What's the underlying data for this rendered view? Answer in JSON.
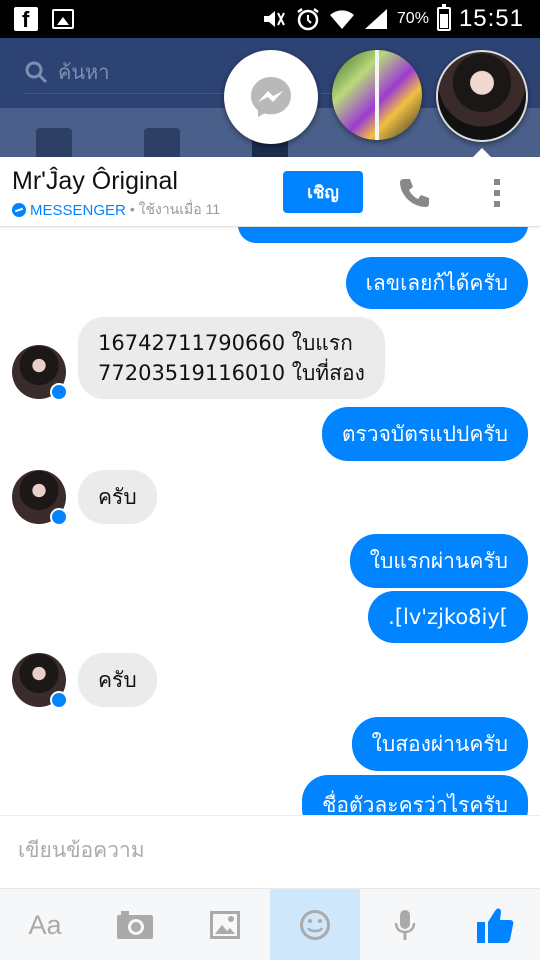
{
  "status_bar": {
    "battery": "70%",
    "time": "15:51",
    "icons": [
      "facebook-icon",
      "image-notification-icon",
      "mute-icon",
      "alarm-icon",
      "wifi-icon",
      "signal-icon",
      "battery-icon"
    ]
  },
  "facebook": {
    "search_placeholder": "ค้นหา",
    "brand_color": "#2d4373"
  },
  "chat_heads": [
    "messenger-chathead",
    "friend-photo-chathead",
    "anime-avatar-chathead"
  ],
  "chat": {
    "name": "Mr'Ĵay Ôriginal",
    "brand": "MESSENGER",
    "active_status": "• ใช้งานเมื่อ 11",
    "invite_label": "เชิญ",
    "accent": "#0084ff"
  },
  "messages": [
    {
      "dir": "out",
      "text": ""
    },
    {
      "dir": "out",
      "text": "เลขเลยก้ได้ครับ"
    },
    {
      "dir": "in",
      "lines": [
        "16742711790660 ใบแรก",
        "77203519116010 ใบที่สอง"
      ]
    },
    {
      "dir": "out",
      "text": "ตรวจบัตรแปปครับ"
    },
    {
      "dir": "in",
      "text": "ครับ"
    },
    {
      "dir": "out",
      "text": "ใบแรกผ่านครับ"
    },
    {
      "dir": "out",
      "text": ".[lv'zjko8iy["
    },
    {
      "dir": "in",
      "text": "ครับ"
    },
    {
      "dir": "out",
      "text": "ใบสองผ่านครับ"
    },
    {
      "dir": "out",
      "text": "ชื่อตัวละครว่าไรครับ"
    }
  ],
  "composer": {
    "placeholder": "เขียนข้อความ"
  },
  "toolbar": {
    "aa_label": "Aa",
    "active": "emoji"
  }
}
